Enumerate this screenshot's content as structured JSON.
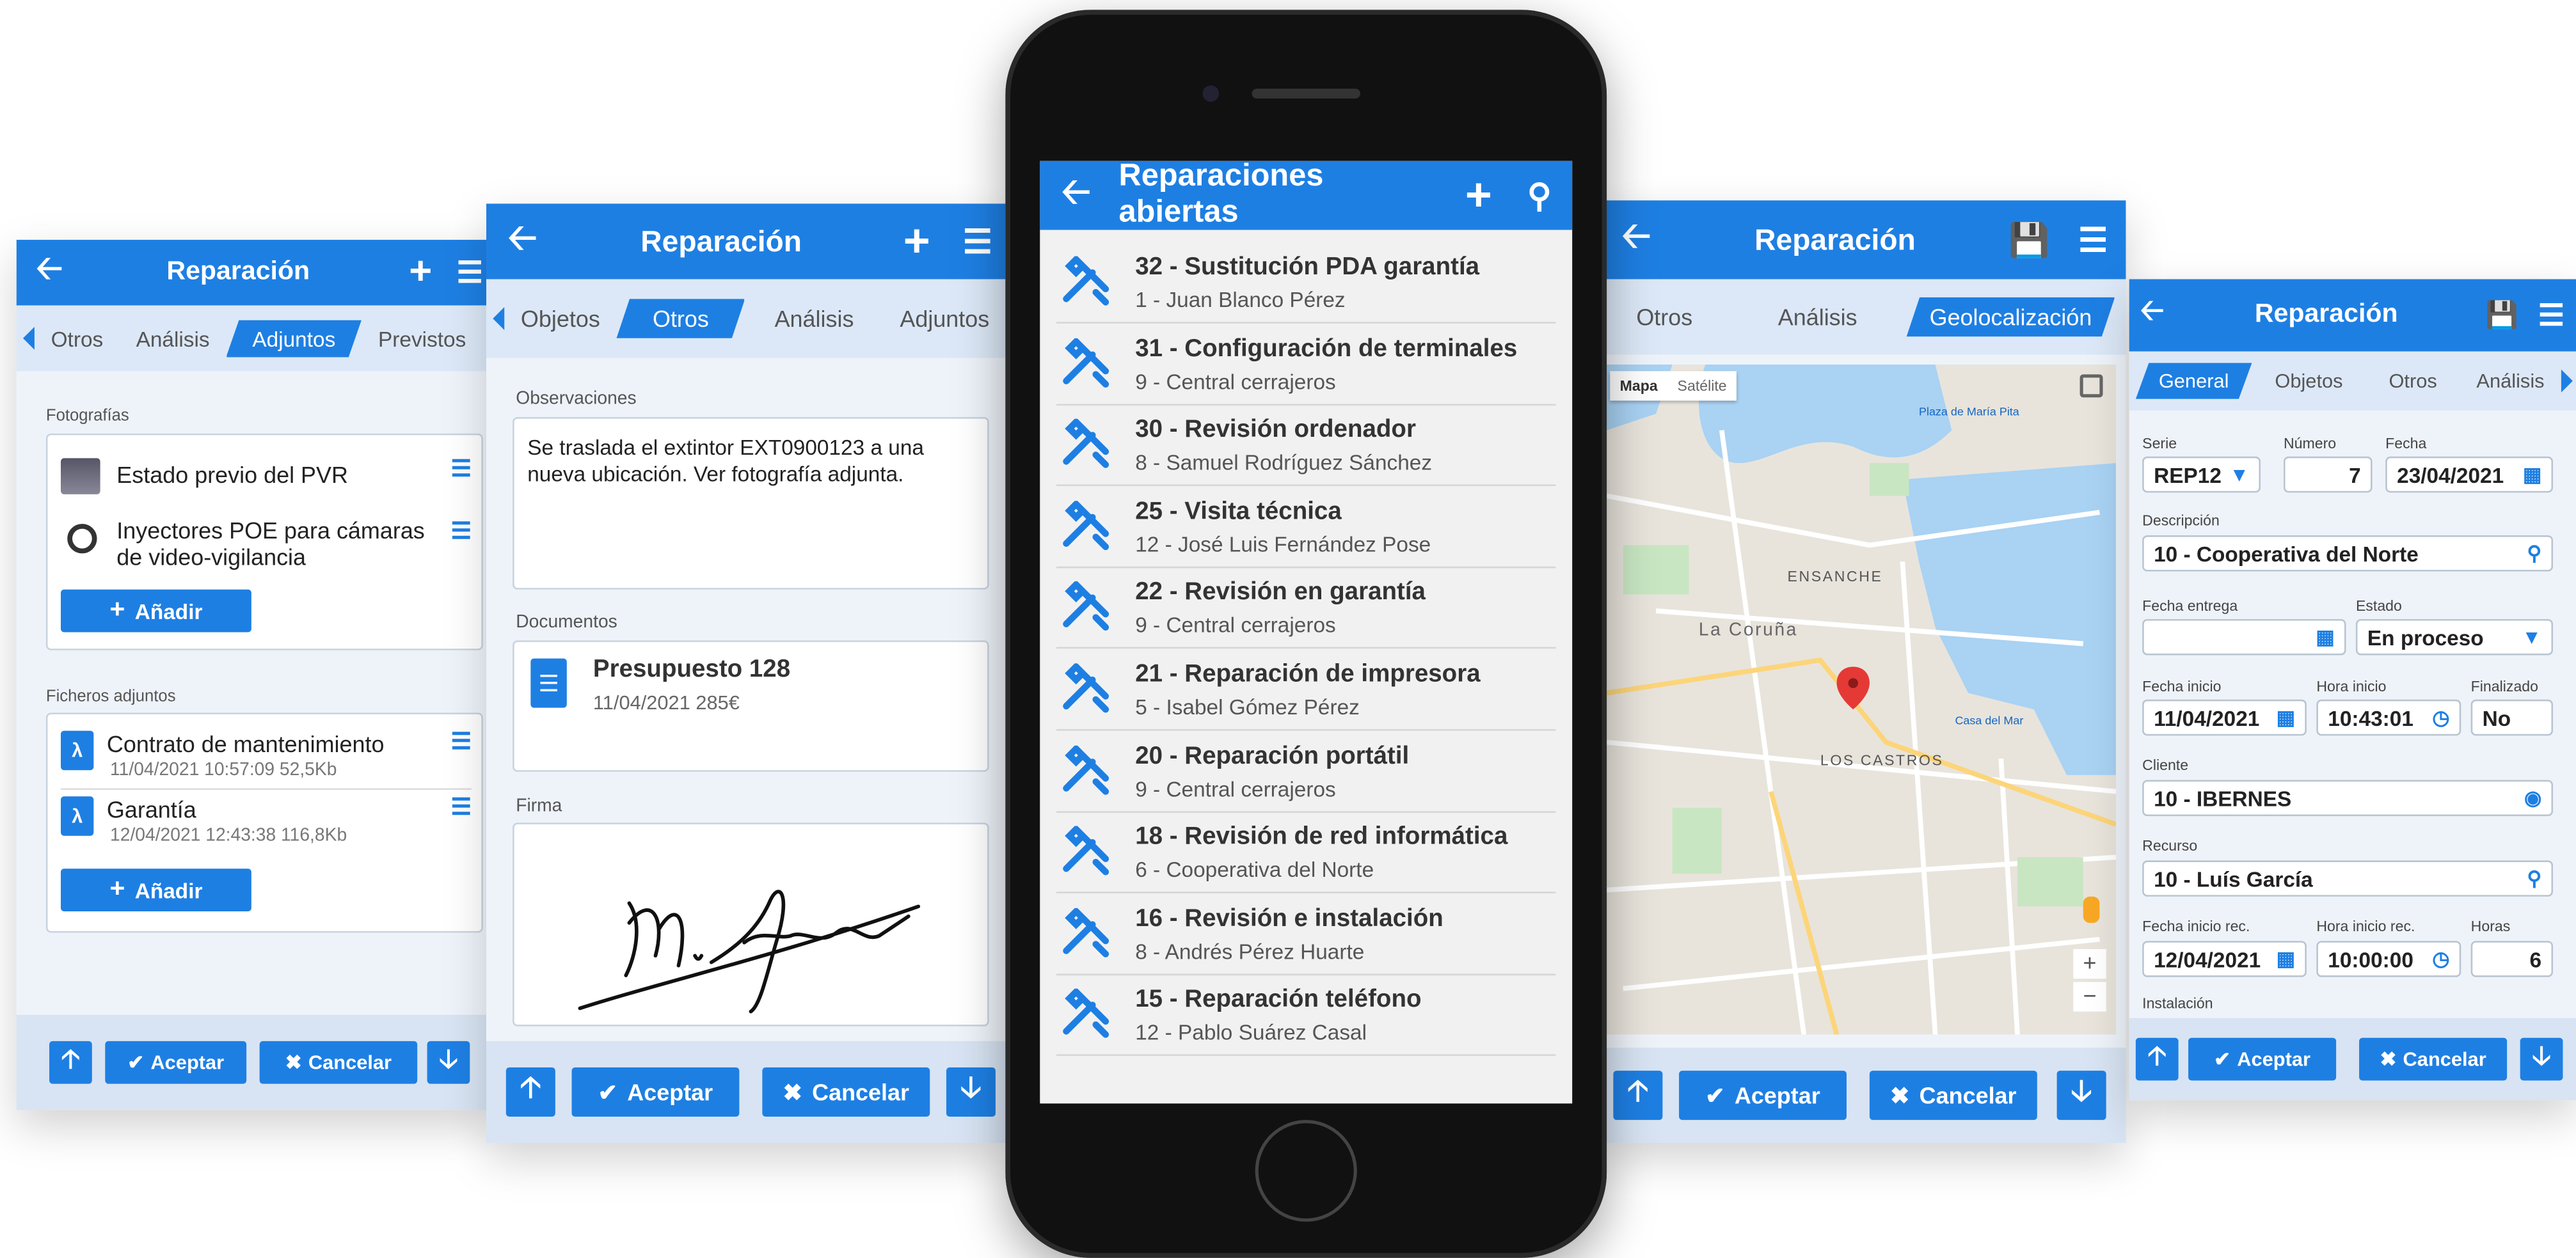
{
  "colors": {
    "primary": "#1e7fe3",
    "tab_bg": "#dce8f7",
    "footer_bg": "#d8e4f3",
    "phone": "#111111"
  },
  "screen1": {
    "title": "Reparación",
    "add_icon": "plus-icon",
    "menu_icon": "menu-icon",
    "tabs": [
      "Otros",
      "Análisis",
      "Adjuntos",
      "Previstos"
    ],
    "active_tab": "Adjuntos",
    "photos_label": "Fotografías",
    "photos": [
      {
        "title": "Estado previo del PVR"
      },
      {
        "title": "Inyectores POE para cámaras de video-vigilancia"
      }
    ],
    "add_label": "Añadir",
    "files_label": "Ficheros adjuntos",
    "files": [
      {
        "title": "Contrato de mantenimiento",
        "meta": "11/04/2021 10:57:09  52,5Kb"
      },
      {
        "title": "Garantía",
        "meta": "12/04/2021 12:43:38  116,8Kb"
      }
    ],
    "accept": "Aceptar",
    "cancel": "Cancelar"
  },
  "screen2": {
    "title": "Reparación",
    "tabs": [
      "Objetos",
      "Otros",
      "Análisis",
      "Adjuntos"
    ],
    "active_tab": "Otros",
    "obs_label": "Observaciones",
    "obs_text": "Se traslada el extintor  EXT0900123 a una nueva ubicación. Ver fotografía adjunta.",
    "docs_label": "Documentos",
    "doc_title": "Presupuesto 128",
    "doc_meta": "11/04/2021 285€",
    "sign_label": "Firma",
    "accept": "Aceptar",
    "cancel": "Cancelar"
  },
  "phone": {
    "title": "Reparaciones abiertas",
    "items": [
      {
        "title": "32 - Sustitución PDA garantía",
        "sub": "1 - Juan Blanco Pérez"
      },
      {
        "title": "31 - Configuración de terminales",
        "sub": "9 - Central cerrajeros"
      },
      {
        "title": "30 - Revisión ordenador",
        "sub": "8 - Samuel Rodríguez Sánchez"
      },
      {
        "title": "25 - Visita técnica",
        "sub": "12 - José Luis Fernández Pose"
      },
      {
        "title": "22 - Revisión en garantía",
        "sub": "9 - Central cerrajeros"
      },
      {
        "title": "21 - Reparación de impresora",
        "sub": "5 - Isabel Gómez Pérez"
      },
      {
        "title": "20 - Reparación portátil",
        "sub": "9 - Central cerrajeros"
      },
      {
        "title": "18 - Revisión de red informática",
        "sub": "6 - Cooperativa del Norte"
      },
      {
        "title": "16 - Revisión e instalación",
        "sub": "8 - Andrés Pérez Huarte"
      },
      {
        "title": "15 - Reparación teléfono",
        "sub": "12 - Pablo Suárez Casal"
      }
    ]
  },
  "screen4": {
    "title": "Reparación",
    "tabs": [
      "Otros",
      "Análisis",
      "Geolocalización"
    ],
    "active_tab": "Geolocalización",
    "map_tab": "Mapa",
    "sat_tab": "Satélite",
    "places": [
      "ENSANCHE",
      "La Coruña",
      "LOS CASTROS",
      "Plaza de María Pita",
      "Casa del Mar"
    ],
    "accept": "Aceptar",
    "cancel": "Cancelar"
  },
  "screen5": {
    "title": "Reparación",
    "tabs": [
      "General",
      "Objetos",
      "Otros",
      "Análisis"
    ],
    "active_tab": "General",
    "serie_label": "Serie",
    "serie": "REP12",
    "numero_label": "Número",
    "numero": "7",
    "fecha_label": "Fecha",
    "fecha": "23/04/2021",
    "desc_label": "Descripción",
    "desc": "10 - Cooperativa del Norte",
    "entrega_label": "Fecha entrega",
    "entrega": "",
    "estado_label": "Estado",
    "estado": "En proceso",
    "finicio_label": "Fecha inicio",
    "finicio": "11/04/2021",
    "hinicio_label": "Hora inicio",
    "hinicio": "10:43:01",
    "fin_label": "Finalizado",
    "fin": "No",
    "cliente_label": "Cliente",
    "cliente": "10 - IBERNES",
    "recurso_label": "Recurso",
    "recurso": "10 - Luís García",
    "finrec_label": "Fecha inicio rec.",
    "finrec": "12/04/2021",
    "hinrec_label": "Hora inicio rec.",
    "hinrec": "10:00:00",
    "horas_label": "Horas",
    "horas": "6",
    "inst_label": "Instalación",
    "accept": "Aceptar",
    "cancel": "Cancelar"
  }
}
